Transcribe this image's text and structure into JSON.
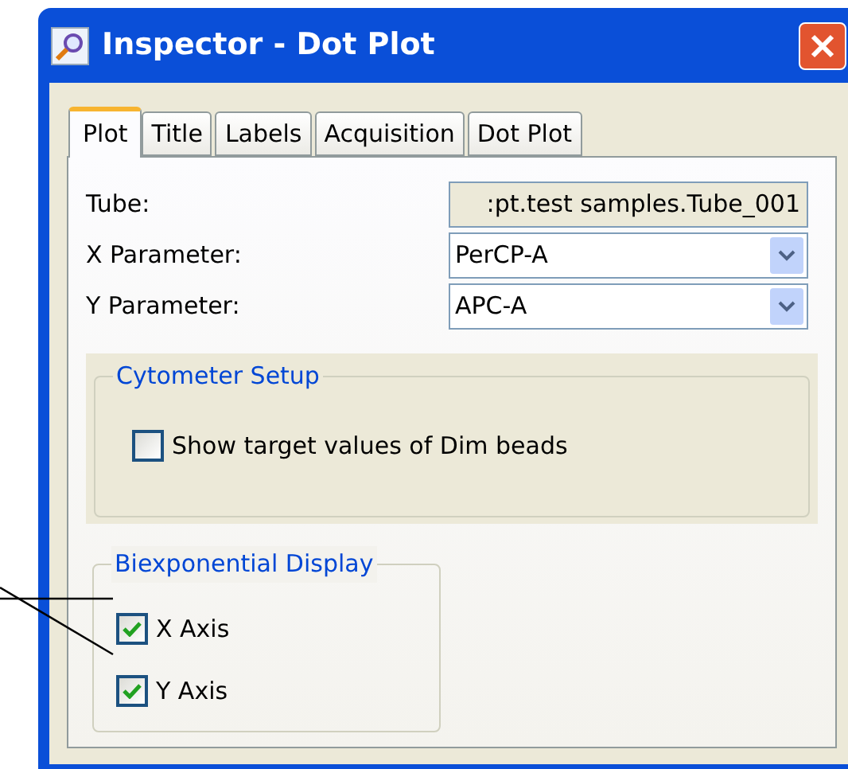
{
  "window": {
    "title": "Inspector - Dot Plot"
  },
  "tabs": [
    {
      "label": "Plot",
      "selected": true
    },
    {
      "label": "Title",
      "selected": false
    },
    {
      "label": "Labels",
      "selected": false
    },
    {
      "label": "Acquisition",
      "selected": false
    },
    {
      "label": "Dot Plot",
      "selected": false
    }
  ],
  "fields": [
    {
      "label": "Tube:",
      "value": ":pt.test samples.Tube_001",
      "kind": "readonly"
    },
    {
      "label": "X Parameter:",
      "value": "PerCP-A",
      "kind": "dropdown"
    },
    {
      "label": "Y Parameter:",
      "value": "APC-A",
      "kind": "dropdown"
    }
  ],
  "cytometer_setup": {
    "title": "Cytometer Setup",
    "checkboxes": [
      {
        "label": "Show target values of Dim beads",
        "checked": false
      }
    ]
  },
  "biexponential_display": {
    "title": "Biexponential Display",
    "checkboxes": [
      {
        "label": "X Axis",
        "checked": true
      },
      {
        "label": "Y Axis",
        "checked": true
      }
    ]
  }
}
